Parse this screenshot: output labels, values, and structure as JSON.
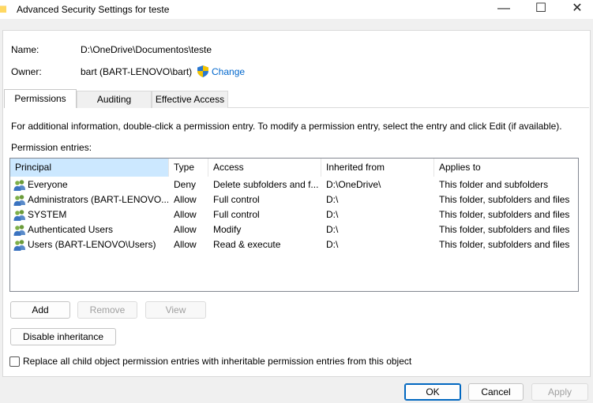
{
  "window": {
    "title": "Advanced Security Settings for teste",
    "controls": {
      "minimize": "—",
      "maximize": "☐",
      "close": "✕"
    }
  },
  "object": {
    "name_label": "Name:",
    "name_value": "D:\\OneDrive\\Documentos\\teste",
    "owner_label": "Owner:",
    "owner_value": "bart (BART-LENOVO\\bart)",
    "change_label": "Change"
  },
  "tabs": [
    {
      "label": "Permissions",
      "active": true
    },
    {
      "label": "Auditing",
      "active": false
    },
    {
      "label": "Effective Access",
      "active": false
    }
  ],
  "permissions": {
    "info_text": "For additional information, double-click a permission entry. To modify a permission entry, select the entry and click Edit (if available).",
    "entries_label": "Permission entries:",
    "columns": [
      "Principal",
      "Type",
      "Access",
      "Inherited from",
      "Applies to"
    ],
    "rows": [
      {
        "principal": "Everyone",
        "type": "Deny",
        "access": "Delete subfolders and f...",
        "inherited_from": "D:\\OneDrive\\",
        "applies_to": "This folder and subfolders"
      },
      {
        "principal": "Administrators (BART-LENOVO...",
        "type": "Allow",
        "access": "Full control",
        "inherited_from": "D:\\",
        "applies_to": "This folder, subfolders and files"
      },
      {
        "principal": "SYSTEM",
        "type": "Allow",
        "access": "Full control",
        "inherited_from": "D:\\",
        "applies_to": "This folder, subfolders and files"
      },
      {
        "principal": "Authenticated Users",
        "type": "Allow",
        "access": "Modify",
        "inherited_from": "D:\\",
        "applies_to": "This folder, subfolders and files"
      },
      {
        "principal": "Users (BART-LENOVO\\Users)",
        "type": "Allow",
        "access": "Read & execute",
        "inherited_from": "D:\\",
        "applies_to": "This folder, subfolders and files"
      }
    ],
    "add_label": "Add",
    "remove_label": "Remove",
    "view_label": "View",
    "disable_inheritance_label": "Disable inheritance",
    "replace_checkbox_label": "Replace all child object permission entries with inheritable permission entries from this object",
    "replace_checked": false
  },
  "footer": {
    "ok_label": "OK",
    "cancel_label": "Cancel",
    "apply_label": "Apply"
  },
  "colors": {
    "accent": "#0067c0",
    "link": "#0066cc",
    "selected_header": "#cce8ff",
    "disabled_text": "#a0a0a0"
  },
  "icons": [
    "folder-icon",
    "uac-shield-icon",
    "user-group-icon"
  ]
}
